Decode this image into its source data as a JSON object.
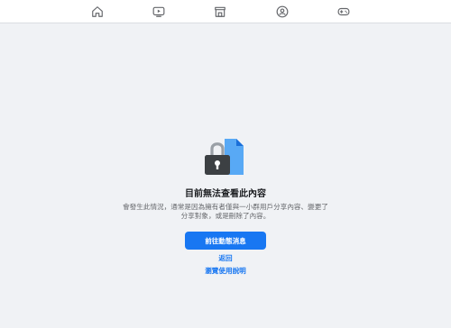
{
  "topnav": {
    "items": [
      {
        "icon": "home-icon"
      },
      {
        "icon": "watch-video-icon"
      },
      {
        "icon": "marketplace-icon"
      },
      {
        "icon": "groups-icon"
      },
      {
        "icon": "gaming-icon"
      }
    ]
  },
  "content": {
    "illustration": "locked-content-icon",
    "title": "目前無法查看此內容",
    "description": "會發生此情況，通常是因為擁有者僅與一小群用戶分享內容、變更了分享對象，或是刪除了內容。",
    "primary_button": "前往動態消息",
    "back_link": "返回",
    "help_link": "瀏覽使用說明"
  },
  "colors": {
    "accent": "#1877f2",
    "background": "#f0f2f5",
    "icon_gray": "#65676b"
  }
}
